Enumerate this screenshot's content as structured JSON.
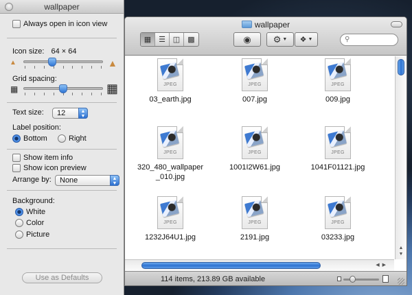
{
  "panel": {
    "title": "wallpaper",
    "always_open_icon_view": "Always open in icon view",
    "icon_size_label": "Icon size:",
    "icon_size_value": "64 × 64",
    "icon_size_level": 0.35,
    "grid_spacing_label": "Grid spacing:",
    "grid_spacing_level": 0.5,
    "text_size_label": "Text size:",
    "text_size_value": "12",
    "label_position_label": "Label position:",
    "label_position_options": [
      "Bottom",
      "Right"
    ],
    "label_position_selected": "Bottom",
    "show_item_info": "Show item info",
    "show_icon_preview": "Show icon preview",
    "arrange_by_label": "Arrange by:",
    "arrange_by_value": "None",
    "background_label": "Background:",
    "background_options": [
      "White",
      "Color",
      "Picture"
    ],
    "background_selected": "White",
    "defaults_button": "Use as Defaults"
  },
  "finder": {
    "title": "wallpaper",
    "view_modes": [
      "icon-view",
      "list-view",
      "column-view",
      "cover-flow-view"
    ],
    "active_view": "icon-view",
    "buttons": [
      "eye-icon",
      "gear-icon",
      "dropbox-icon"
    ],
    "files": [
      {
        "name": "03_earth.jpg",
        "kind": "JPEG"
      },
      {
        "name": "007.jpg",
        "kind": "JPEG"
      },
      {
        "name": "009.jpg",
        "kind": "JPEG"
      },
      {
        "name": "320_480_wallpaper _010.jpg",
        "kind": "JPEG"
      },
      {
        "name": "1001I2W61.jpg",
        "kind": "JPEG"
      },
      {
        "name": "1041F01121.jpg",
        "kind": "JPEG"
      },
      {
        "name": "1232J64U1.jpg",
        "kind": "JPEG"
      },
      {
        "name": "2191.jpg",
        "kind": "JPEG"
      },
      {
        "name": "03233.jpg",
        "kind": "JPEG"
      }
    ],
    "status": "114 items, 213.89 GB available"
  },
  "colors": {
    "accent": "#2f73d1",
    "panel_bg": "#e8e8e8"
  }
}
